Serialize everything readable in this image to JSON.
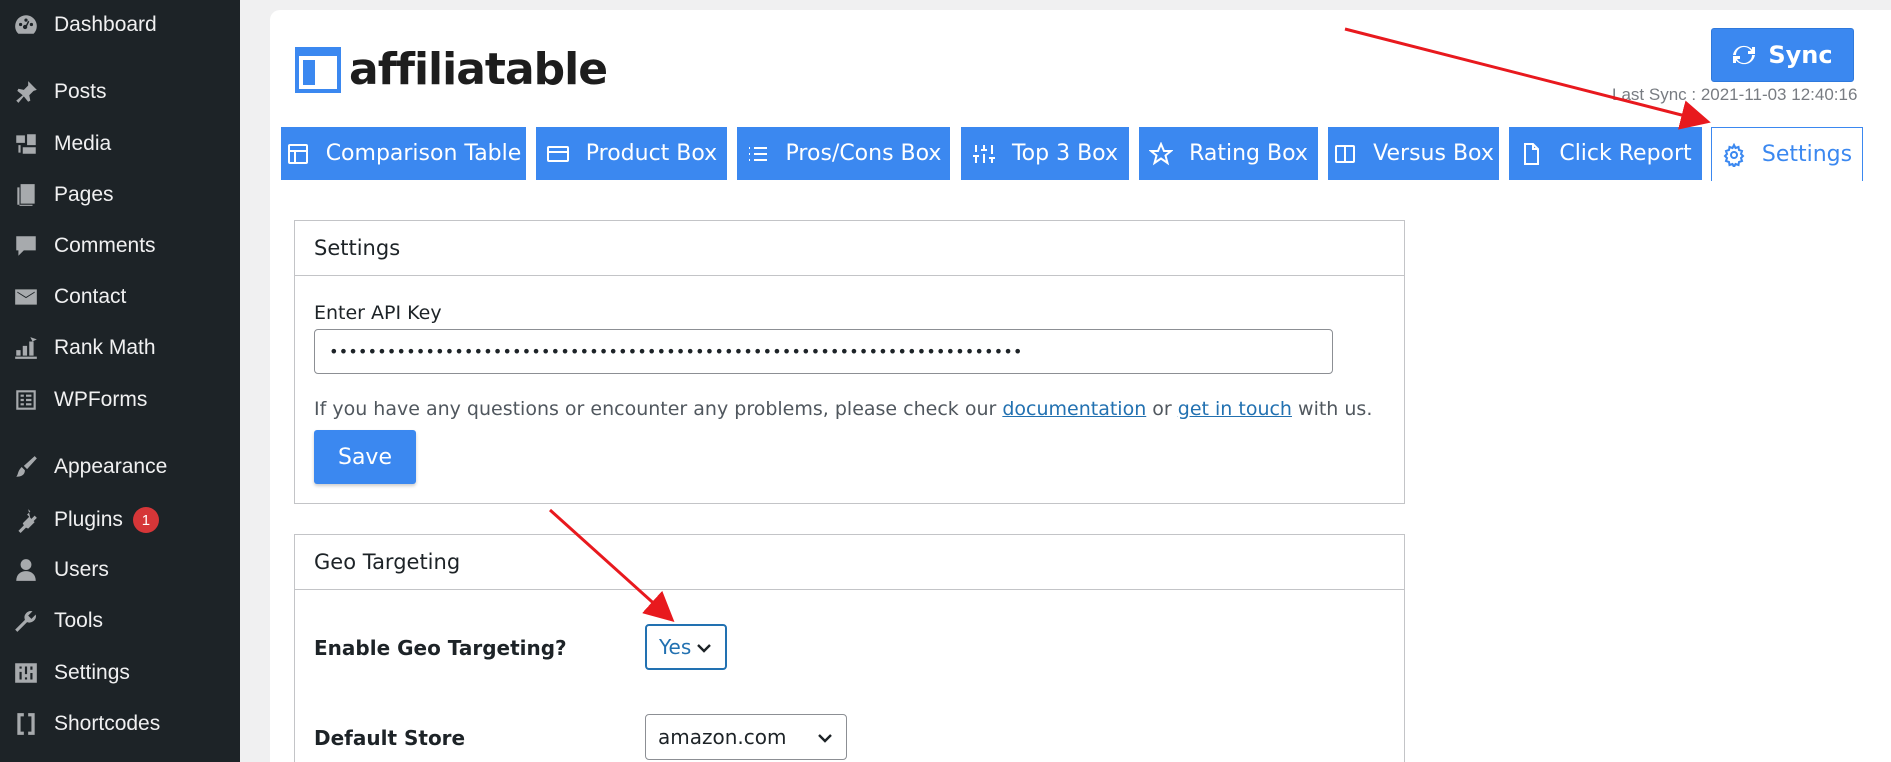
{
  "sidebar": {
    "items": [
      {
        "label": "Dashboard",
        "icon": "dashboard-icon"
      },
      {
        "label": "Posts",
        "icon": "pin-icon"
      },
      {
        "label": "Media",
        "icon": "media-icon"
      },
      {
        "label": "Pages",
        "icon": "pages-icon"
      },
      {
        "label": "Comments",
        "icon": "comment-icon"
      },
      {
        "label": "Contact",
        "icon": "mail-icon"
      },
      {
        "label": "Rank Math",
        "icon": "chart-icon"
      },
      {
        "label": "WPForms",
        "icon": "form-icon"
      },
      {
        "label": "Appearance",
        "icon": "brush-icon"
      },
      {
        "label": "Plugins",
        "icon": "plug-icon",
        "badge": "1"
      },
      {
        "label": "Users",
        "icon": "user-icon"
      },
      {
        "label": "Tools",
        "icon": "wrench-icon"
      },
      {
        "label": "Settings",
        "icon": "sliders-icon"
      },
      {
        "label": "Shortcodes",
        "icon": "brackets-icon"
      }
    ]
  },
  "header": {
    "logo_text": "affiliatable",
    "sync_label": "Sync",
    "last_sync": "Last Sync : 2021-11-03 12:40:16"
  },
  "tabs": [
    {
      "label": "Comparison Table",
      "icon": "table-icon"
    },
    {
      "label": "Product Box",
      "icon": "card-icon"
    },
    {
      "label": "Pros/Cons Box",
      "icon": "list-icon"
    },
    {
      "label": "Top 3 Box",
      "icon": "sliders-icon"
    },
    {
      "label": "Rating Box",
      "icon": "star-icon"
    },
    {
      "label": "Versus Box",
      "icon": "columns-icon"
    },
    {
      "label": "Click Report",
      "icon": "document-icon"
    },
    {
      "label": "Settings",
      "icon": "gear-icon",
      "active": true
    }
  ],
  "settings_panel": {
    "title": "Settings",
    "api_label": "Enter API Key",
    "api_value": "••••••••••••••••••••••••••••••••••••••••••••••••••••••••••••••••••••••••",
    "help_prefix": "If you have any questions or encounter any problems, please check our ",
    "help_link1": "documentation",
    "help_mid": " or ",
    "help_link2": "get in touch",
    "help_suffix": " with us.",
    "save_label": "Save"
  },
  "geo_panel": {
    "title": "Geo Targeting",
    "enable_label": "Enable Geo Targeting?",
    "enable_value": "Yes",
    "store_label": "Default Store",
    "store_value": "amazon.com"
  },
  "colors": {
    "accent": "#3b88f0",
    "sidebar_bg": "#1d2327",
    "annotation_arrow": "#e8191e"
  }
}
